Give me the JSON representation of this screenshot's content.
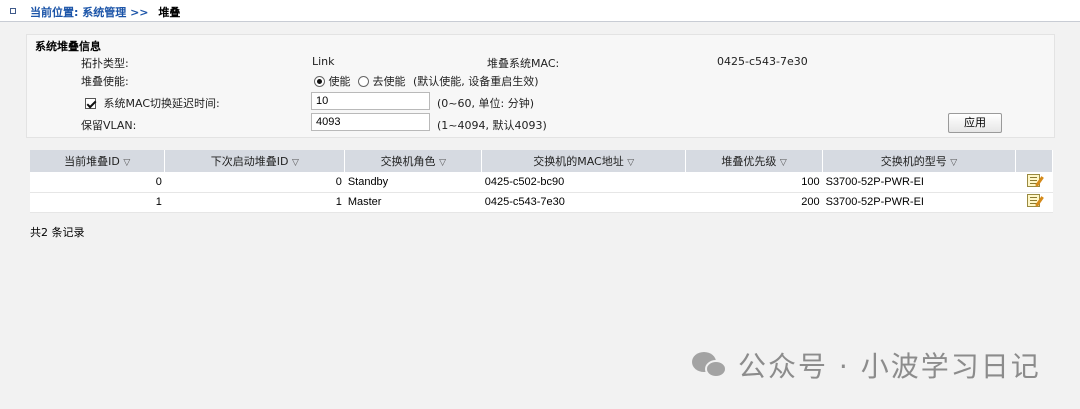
{
  "breadcrumb": {
    "prefix": "当前位置:",
    "section": "系统管理 >>",
    "current": "堆叠"
  },
  "stack_info": {
    "title": "系统堆叠信息",
    "topology_label": "拓扑类型:",
    "topology_value": "Link",
    "stack_mac_label": "堆叠系统MAC:",
    "stack_mac_value": "0425-c543-7e30",
    "enable_label": "堆叠使能:",
    "enable_option": "使能",
    "disable_option": "去使能",
    "enable_note": "(默认使能, 设备重启生效)",
    "mac_delay_label": "系统MAC切换延迟时间:",
    "mac_delay_value": "10",
    "mac_delay_hint": "(0~60, 单位: 分钟)",
    "vlan_label": "保留VLAN:",
    "vlan_value": "4093",
    "vlan_hint": "(1~4094, 默认4093)",
    "apply_label": "应用"
  },
  "table": {
    "headers": [
      "当前堆叠ID",
      "下次启动堆叠ID",
      "交换机角色",
      "交换机的MAC地址",
      "堆叠优先级",
      "交换机的型号"
    ],
    "rows": [
      [
        "0",
        "0",
        "Standby",
        "0425-c502-bc90",
        "100",
        "S3700-52P-PWR-EI"
      ],
      [
        "1",
        "1",
        "Master",
        "0425-c543-7e30",
        "200",
        "S3700-52P-PWR-EI"
      ]
    ]
  },
  "records_text": "共2 条记录",
  "watermark": "公众号 · 小波学习日记"
}
